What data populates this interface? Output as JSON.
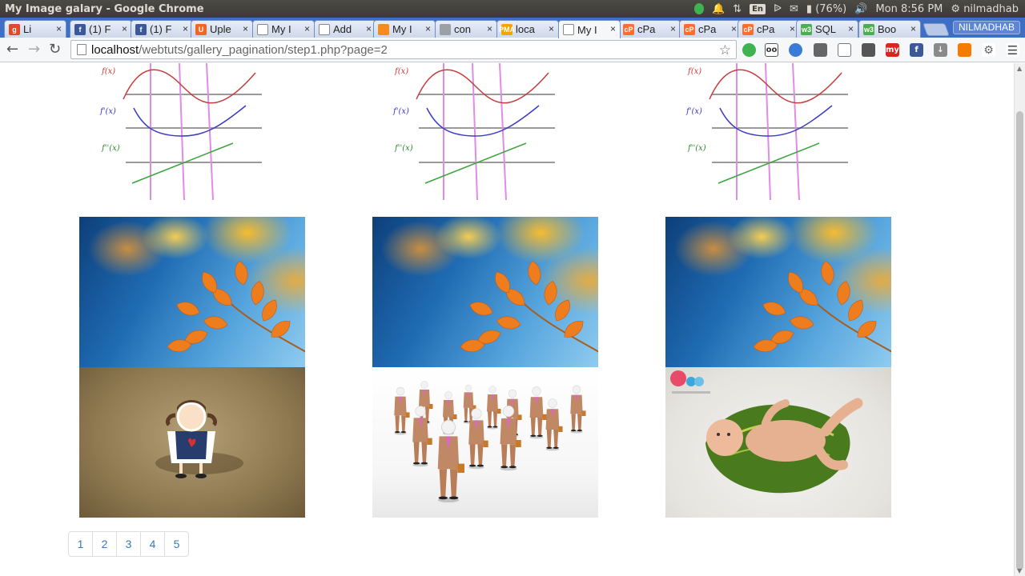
{
  "os": {
    "window_title": "My Image galary - Google Chrome",
    "keyboard_layout": "En",
    "battery": "(76%)",
    "clock": "Mon  8:56 PM",
    "user": "nilmadhab"
  },
  "tabs": [
    {
      "label": "Li",
      "favicon_color": "#e04a2a",
      "favicon_text": "g"
    },
    {
      "label": "(1) F",
      "favicon_color": "#3b5998",
      "favicon_text": "f"
    },
    {
      "label": "(1) F",
      "favicon_color": "#3b5998",
      "favicon_text": "f"
    },
    {
      "label": "Uple",
      "favicon_color": "#f26522",
      "favicon_text": "U"
    },
    {
      "label": "My I",
      "favicon_color": "#ffffff",
      "favicon_text": ""
    },
    {
      "label": "Add",
      "favicon_color": "#ffffff",
      "favicon_text": ""
    },
    {
      "label": "My I",
      "favicon_color": "#f68b1f",
      "favicon_text": ""
    },
    {
      "label": "con",
      "favicon_color": "#9aa0a6",
      "favicon_text": ""
    },
    {
      "label": "loca",
      "favicon_color": "#f0a500",
      "favicon_text": "PMA"
    },
    {
      "label": "My I",
      "favicon_color": "#ffffff",
      "favicon_text": ""
    },
    {
      "label": "cPa",
      "favicon_color": "#ff6c2c",
      "favicon_text": "cP"
    },
    {
      "label": "cPa",
      "favicon_color": "#ff6c2c",
      "favicon_text": "cP"
    },
    {
      "label": "cPa",
      "favicon_color": "#ff6c2c",
      "favicon_text": "cP"
    },
    {
      "label": "SQL",
      "favicon_color": "#4cae4c",
      "favicon_text": "w3"
    },
    {
      "label": "Boo",
      "favicon_color": "#4cae4c",
      "favicon_text": "w3"
    }
  ],
  "profile_button": "NILMADHAB",
  "address_bar": {
    "host": "localhost",
    "path": "/webtuts/gallery_pagination/step1.php?page=2"
  },
  "gallery": {
    "rows": [
      [
        "graph-image",
        "graph-image",
        "graph-image"
      ],
      [
        "autumn-leaf-image",
        "autumn-leaf-image",
        "autumn-leaf-image"
      ],
      [
        "crying-girl-image",
        "business-men-image",
        "baby-on-leaf-image"
      ]
    ],
    "graph_labels": {
      "f": "f(x)",
      "fp": "f'(x)",
      "fpp": "f''(x)"
    }
  },
  "pagination": [
    "1",
    "2",
    "3",
    "4",
    "5"
  ]
}
